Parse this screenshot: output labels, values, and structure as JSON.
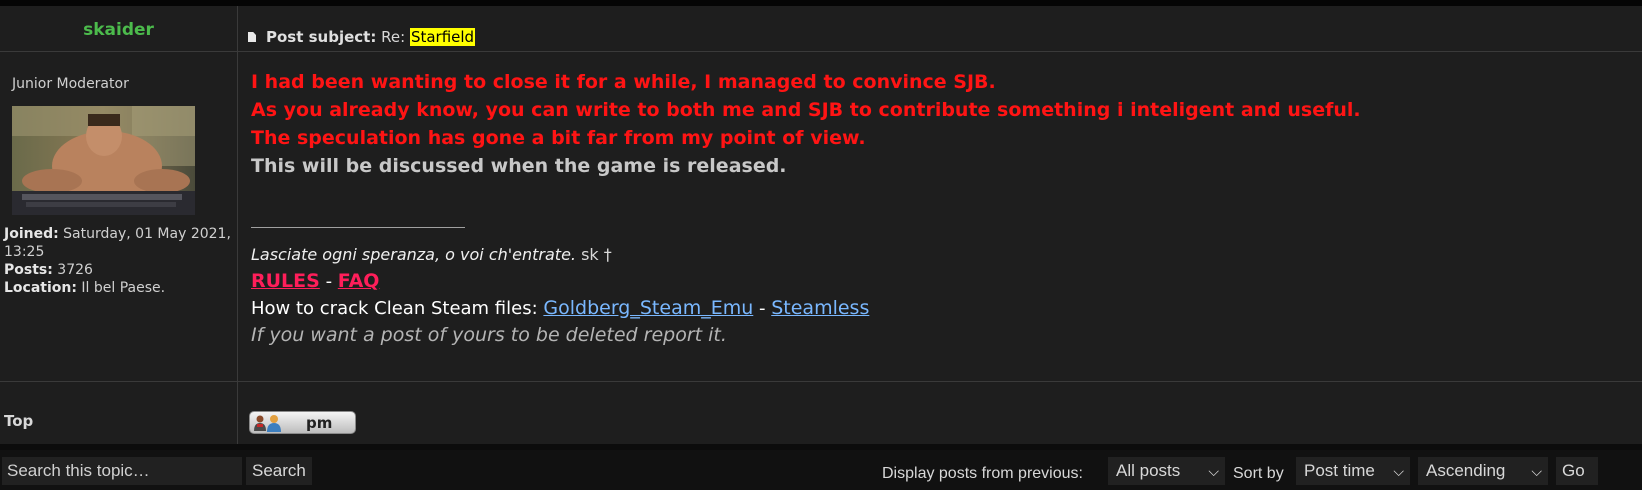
{
  "post": {
    "author": "skaider",
    "rank": "Junior Moderator",
    "subject_label": "Post subject:",
    "subject_prefix": "Re:",
    "subject_highlight": "Starfield",
    "profile": {
      "joined_label": "Joined:",
      "joined_value": "Saturday, 01 May 2021, 13:25",
      "posts_label": "Posts:",
      "posts_value": "3726",
      "location_label": "Location:",
      "location_value": "Il bel Paese."
    },
    "body_red": [
      "I had been wanting to close it for a while, I managed to convince SJB.",
      "As you already know, you can write to both me and SJB to contribute something i inteligent and useful.",
      "The speculation has gone a bit far from my point of view."
    ],
    "body_grey": "This will be discussed when the game is released.",
    "signature": {
      "quote": "Lasciate ogni speranza, o voi ch'entrate.",
      "quote_suffix": " sk †",
      "rules": "RULES",
      "dash": " - ",
      "faq": "FAQ",
      "crack_text": "How to crack Clean Steam files: ",
      "link1": "Goldberg_Steam_Emu",
      "link_sep": " - ",
      "link2": "Steamless",
      "report": "If you want a post of yours to be deleted report it."
    },
    "top_link": "Top",
    "pm_button": "pm"
  },
  "bottom": {
    "search_placeholder": "Search this topic…",
    "search_button": "Search",
    "display_label": "Display posts from previous:",
    "display_value": "All posts",
    "sort_label": "Sort by",
    "sort_value": "Post time",
    "order_value": "Ascending",
    "go_button": "Go"
  },
  "colors": {
    "author": "#4cbb4c",
    "red_text": "#ff1414",
    "rules": "#ff1e5a",
    "link": "#7ab8ff",
    "highlight": "#ffff00"
  },
  "icons": [
    "document-icon",
    "users-icon",
    "chevron-down-icon"
  ]
}
